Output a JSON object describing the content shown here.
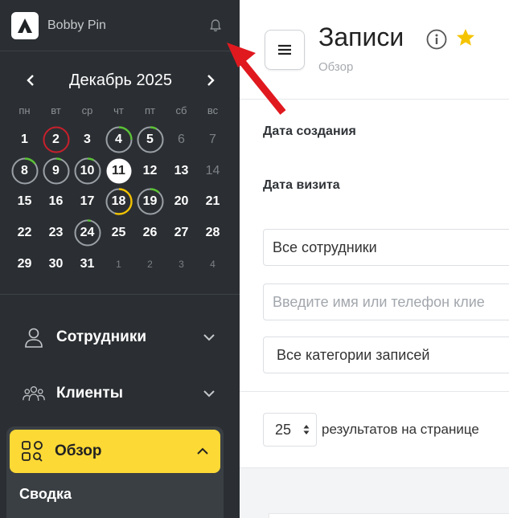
{
  "sidebar": {
    "brand": "Bobby Pin",
    "calendar": {
      "title": "Декабрь 2025",
      "weekdays": [
        "пн",
        "вт",
        "ср",
        "чт",
        "пт",
        "сб",
        "вс"
      ],
      "days": [
        "1",
        "2",
        "3",
        "4",
        "5",
        "6",
        "7",
        "8",
        "9",
        "10",
        "11",
        "12",
        "13",
        "14",
        "15",
        "16",
        "17",
        "18",
        "19",
        "20",
        "21",
        "22",
        "23",
        "24",
        "25",
        "26",
        "27",
        "28",
        "29",
        "30",
        "31",
        "1",
        "2",
        "3",
        "4"
      ]
    },
    "menu": {
      "employees": "Сотрудники",
      "clients": "Клиенты",
      "overview": "Обзор",
      "summary": "Сводка"
    }
  },
  "header": {
    "title": "Записи",
    "subtitle": "Обзор"
  },
  "filters": {
    "created_label": "Дата создания",
    "visit_label": "Дата визита",
    "employees_value": "Все сотрудники",
    "search_placeholder": "Введите имя или телефон клие",
    "categories_value": "Все категории записей"
  },
  "pager": {
    "per_page": "25",
    "label": "результатов на странице"
  },
  "colors": {
    "sidebar_bg": "#2b2f33",
    "accent_yellow": "#fdd935",
    "ring_gray": "#9aa0a6",
    "ring_green": "#5bc236",
    "ring_red": "#c8202c",
    "ring_yellow": "#f2c200",
    "annotation_red": "#e0191f"
  }
}
